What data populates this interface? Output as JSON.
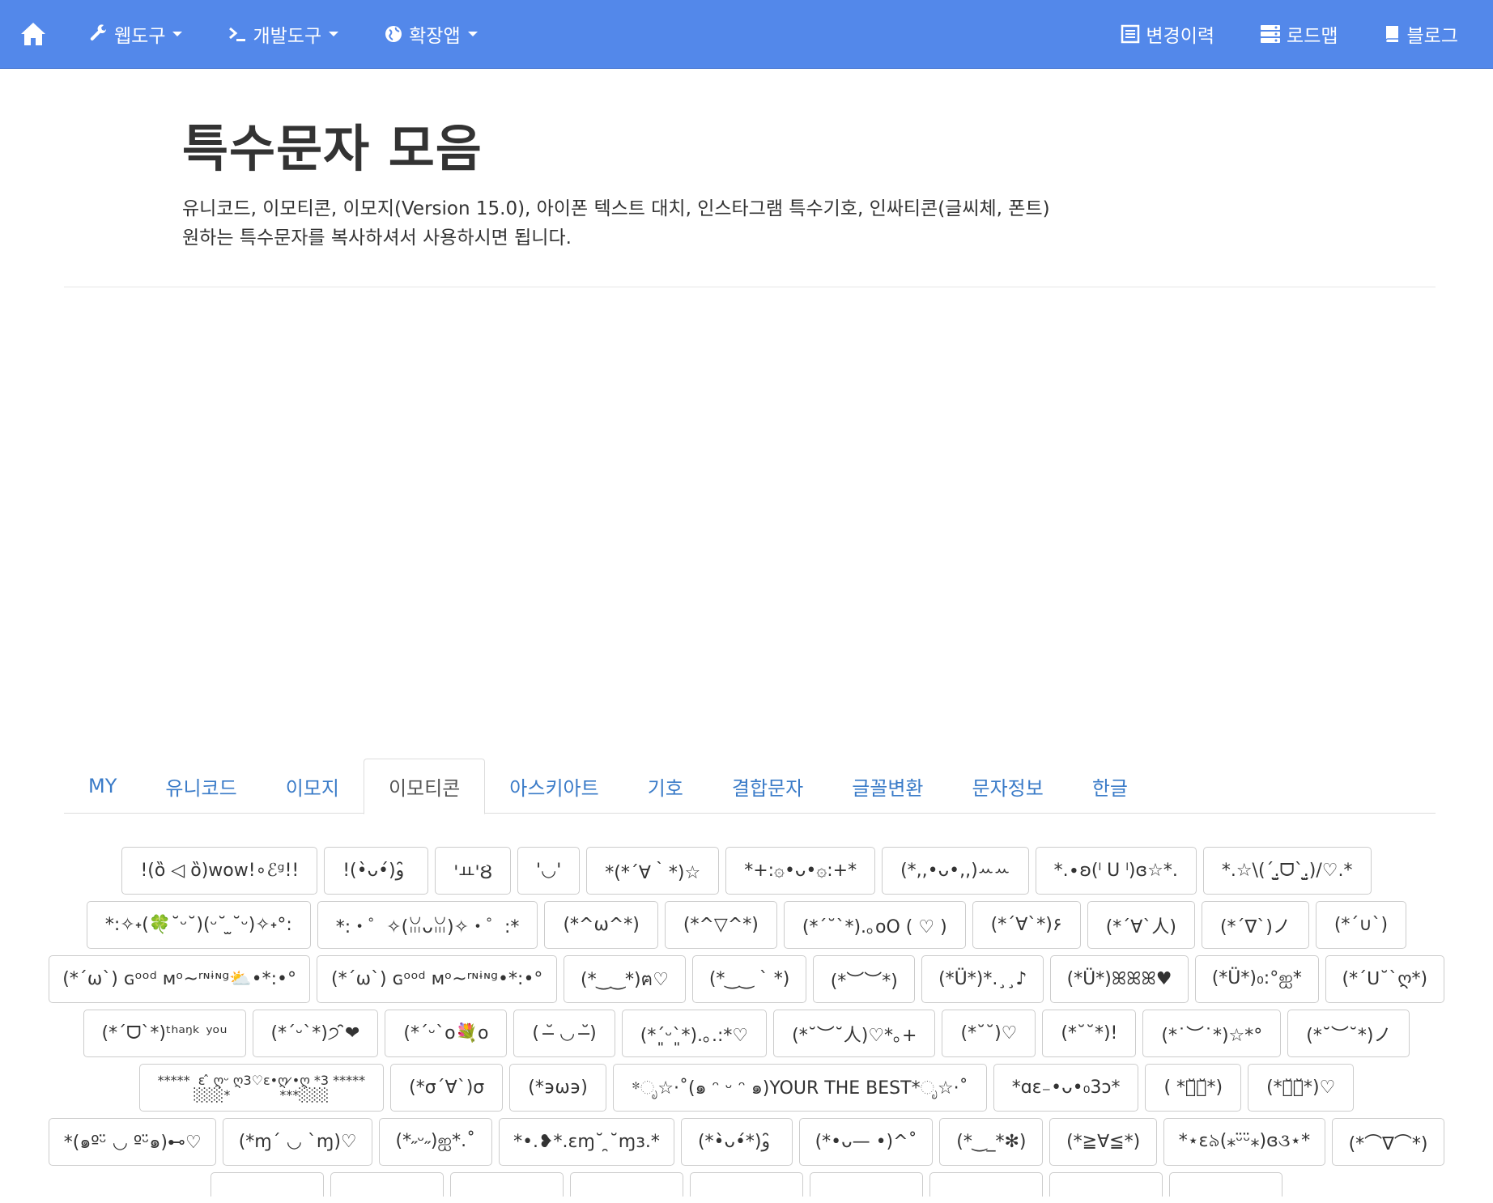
{
  "navbar": {
    "home_icon": "home-icon",
    "left_items": [
      {
        "label": "웹도구",
        "icon": "wrench-icon"
      },
      {
        "label": "개발도구",
        "icon": "terminal-icon"
      },
      {
        "label": "확장앱",
        "icon": "globe-icon"
      }
    ],
    "right_items": [
      {
        "label": "변경이력",
        "icon": "list-icon"
      },
      {
        "label": "로드맵",
        "icon": "server-icon"
      },
      {
        "label": "블로그",
        "icon": "book-icon"
      }
    ],
    "colors": {
      "background": "#5388ea"
    }
  },
  "header": {
    "title": "특수문자 모음",
    "desc_line1": "유니코드, 이모티콘, 이모지(Version 15.0), 아이폰 텍스트 대치, 인스타그램 특수기호, 인싸티콘(글씨체, 폰트)",
    "desc_line2": "원하는 특수문자를 복사하셔서 사용하시면 됩니다."
  },
  "tabs": [
    {
      "label": "MY",
      "active": false
    },
    {
      "label": "유니코드",
      "active": false
    },
    {
      "label": "이모지",
      "active": false
    },
    {
      "label": "이모티콘",
      "active": true
    },
    {
      "label": "아스키아트",
      "active": false
    },
    {
      "label": "기호",
      "active": false
    },
    {
      "label": "결합문자",
      "active": false
    },
    {
      "label": "글꼴변환",
      "active": false
    },
    {
      "label": "문자정보",
      "active": false
    },
    {
      "label": "한글",
      "active": false
    }
  ],
  "emoticon_rows": [
    [
      "!(ȍ ◁ ȍ)wow!∘ℰᵍ!!",
      "!(•̀ᴗ•́)و ̑̑",
      "'ㅛ'Ȣ",
      "'◡'",
      "*(*´∀｀*)☆",
      "*+:۞•ᴗ•۞:+*",
      "(*,,•ᴗ•,,)ꕀꕀ",
      "*.∙ʚ(ˡ U ˡ)ɞ☆*.",
      "*.☆\\(ˊ.̫̮ᗜˋ.̫̮)/♡.*"
    ],
    [
      "*:✧˖(🍀˘ᵕ˘)(ᵕ˘ ̫˘ᵕ)✧˖°:",
      "*:・゜✧(ꈍᴗꈍ)✧・゜:*",
      "(*^ω^*)",
      "(*^▽^*)",
      "(*´˘`*).｡oO ( ♡ )",
      "(*´∀`*)۶",
      "(*´∀`人)",
      "(*´∇`)ノ",
      "(*´∪`)"
    ],
    [
      "(*´ω`) ɢᵒᵒᵈ ᴍᵒ~ʳᶰᶤᶰᵍ⛅•*:•°",
      "(*´ω`) ɢᵒᵒᵈ ᴍᵒ~ʳᶰᶤᶰᵍ•*:•°",
      "(*‿‿*)ฅ♡",
      "(*‿‿ ` *)",
      "(*︶︶*)",
      "(*Ü*)*.¸¸♪",
      "(*Ü*)ꕤꕤꕤ♥",
      "(*Ü*)₀:°ஐ*",
      "(*´ᑌ˘`ღ*)"
    ],
    [
      "(*´ᗜ`*)ᵗʰᵃᵑᵏ ʸᵒᵘ",
      "(*´ᵕ`*)੭ ̑̑❤",
      "(*´ᵕ`o💐o",
      "( ˘̶ ◡ ˘̶)",
      "(*ˊ͈ᵕˋ͈*).｡.:*♡",
      "(*˘︶˘人)♡*｡+",
      "(*˘˘)♡",
      "(*˘˘*)!",
      "(*˙︶˙*)☆*°",
      "(*˘︶˘*)ノ"
    ],
    [
      "*****  ɛ ̂ ღᵕ ღ3♡ɛ•ღ ̷•ღ *3 *****\n░░░*            ***░░░",
      "(*σ´∀`)σ",
      "(*϶ω϶)",
      "*ೃ☆·˚(๑ ᵔ ᵕ ᵔ ๑)YOUR THE BEST*ೃ☆·˚",
      "*ɑɛ₋•ᴗ•₀3ɔ*",
      "( *ค̆ค̆*)",
      "(*ค̆ค̆*)♡"
    ],
    [
      "*(๑ºᵕ̈ ◡ ºᵕ̈๑)⊷♡",
      "(*ɱ´ ◡ `ɱ)♡",
      "(*˶ᵕ˶)ஐ*.˚",
      "*•.❥*.ɛɱ˘ ̯˘ɱɜ.*",
      "(*•̀ᴗ•́*)و ̑̑",
      "(*•ᴗ— •)^˚",
      "(*‿_*✻)",
      "(*≧∀≦*)",
      "*⋆ɛ৯(⁎ᵕ̈ᵕ̈⁎)ɞ૩⋆*",
      "(*⌒∇⌒*)"
    ]
  ]
}
